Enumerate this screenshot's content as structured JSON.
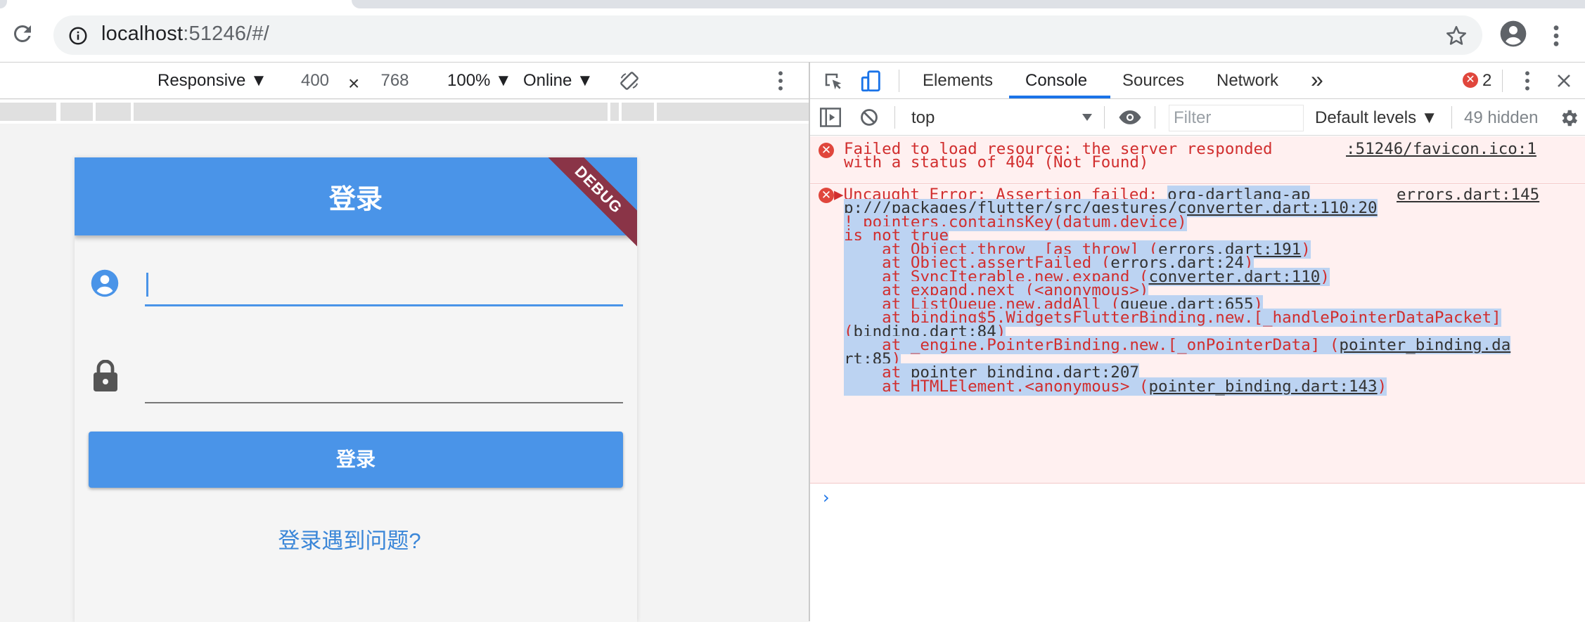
{
  "browser": {
    "url_host": "localhost",
    "url_rest": ":51246/#/"
  },
  "device_toolbar": {
    "device": "Responsive ▼",
    "width": "400",
    "times": "×",
    "height": "768",
    "zoom": "100% ▼",
    "network": "Online ▼"
  },
  "app": {
    "title": "登录",
    "debug_banner": "DEBUG",
    "login_button": "登录",
    "help_link": "登录遇到问题?"
  },
  "devtools": {
    "tabs": [
      "Elements",
      "Console",
      "Sources",
      "Network"
    ],
    "more_tabs": "»",
    "error_count": "2",
    "context": "top",
    "filter_placeholder": "Filter",
    "levels": "Default levels ▼",
    "hidden": "49 hidden"
  },
  "console": {
    "msg1": {
      "line1": "Failed to load resource: the server responded",
      "line2": "with a status of 404 (Not Found)",
      "source": ":51246/favicon.ico:1"
    },
    "msg2": {
      "source": "errors.dart:145",
      "lines": [
        "▶Uncaught Error: Assertion failed: ",
        "org-dartlang-ap",
        "p:///packages/flutter/src/gestures/converter.dart:110:20",
        "!_pointers.containsKey(datum.device)",
        "is not true",
        "    at Object.throw_ [as throw] (",
        "errors.dart:191",
        "    at Object.assertFailed (",
        "errors.dart:24",
        "    at SyncIterable.new.expand (",
        "converter.dart:110",
        "    at expand.next (<anonymous>)",
        "    at ListQueue.new.addAll (",
        "queue.dart:655",
        "    at binding$5.WidgetsFlutterBinding.new.[_handlePointerDataPacket]",
        "(",
        "binding.dart:84",
        "    at _engine.PointerBinding.new.[_onPointerData] (",
        "pointer_binding.da",
        "rt:85",
        "    at ",
        "pointer_binding.dart:207",
        "    at HTMLElement.<anonymous> (",
        "pointer_binding.dart:143",
        ")"
      ]
    },
    "prompt": "›"
  }
}
